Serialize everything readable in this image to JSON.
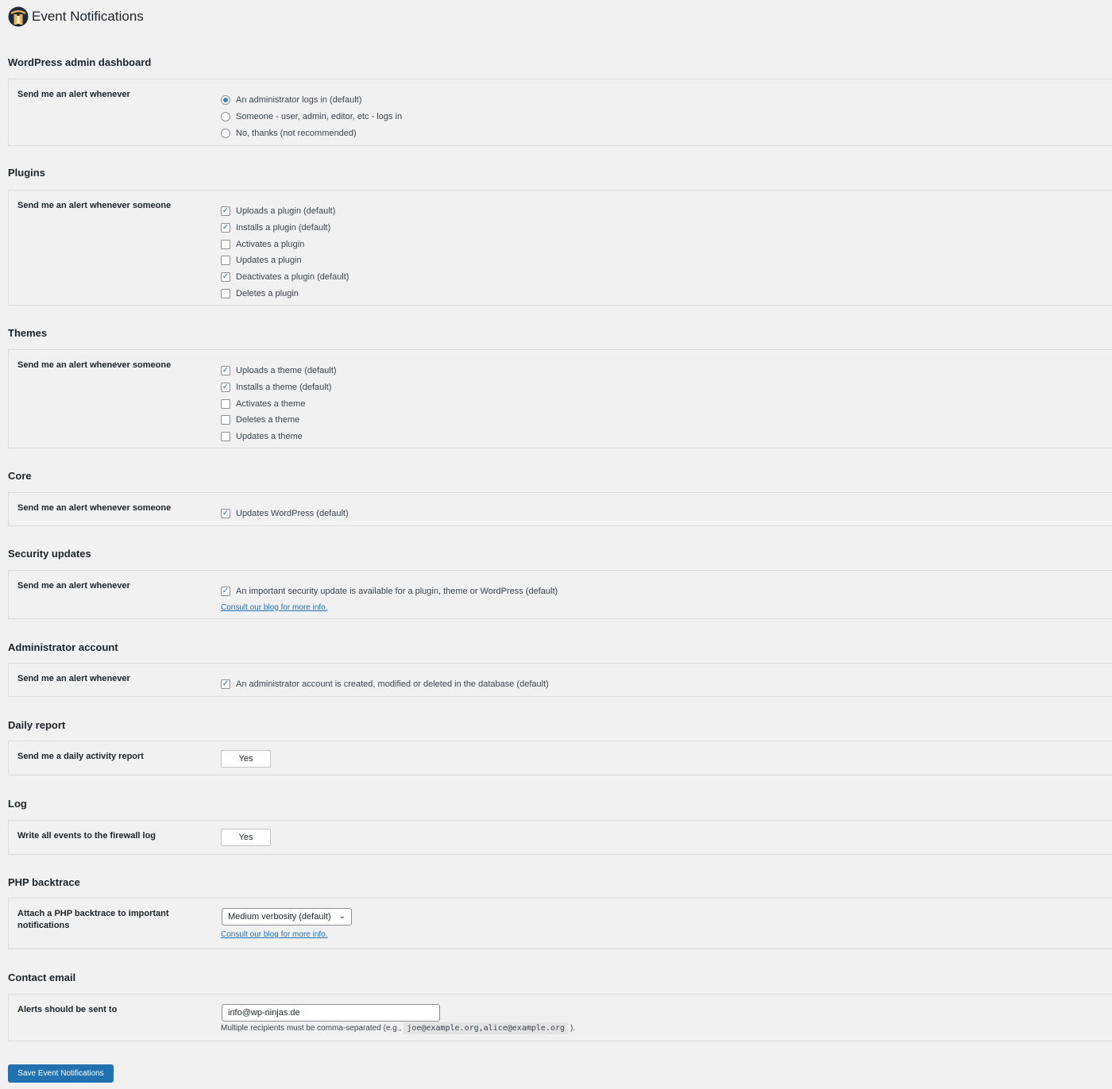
{
  "page": {
    "title": "Event Notifications"
  },
  "sections": {
    "dashboard": {
      "title": "WordPress admin dashboard",
      "label": "Send me an alert whenever",
      "options": [
        {
          "label": "An administrator logs in (default)",
          "checked": true
        },
        {
          "label": "Someone - user, admin, editor, etc - logs in",
          "checked": false
        },
        {
          "label": "No, thanks (not recommended)",
          "checked": false
        }
      ]
    },
    "plugins": {
      "title": "Plugins",
      "label": "Send me an alert whenever someone",
      "options": [
        {
          "label": "Uploads a plugin (default)",
          "checked": true
        },
        {
          "label": "Installs a plugin (default)",
          "checked": true
        },
        {
          "label": "Activates a plugin",
          "checked": false
        },
        {
          "label": "Updates a plugin",
          "checked": false
        },
        {
          "label": "Deactivates a plugin (default)",
          "checked": true
        },
        {
          "label": "Deletes a plugin",
          "checked": false
        }
      ]
    },
    "themes": {
      "title": "Themes",
      "label": "Send me an alert whenever someone",
      "options": [
        {
          "label": "Uploads a theme (default)",
          "checked": true
        },
        {
          "label": "Installs a theme (default)",
          "checked": true
        },
        {
          "label": "Activates a theme",
          "checked": false
        },
        {
          "label": "Deletes a theme",
          "checked": false
        },
        {
          "label": "Updates a theme",
          "checked": false
        }
      ]
    },
    "core": {
      "title": "Core",
      "label": "Send me an alert whenever someone",
      "options": [
        {
          "label": "Updates WordPress (default)",
          "checked": true
        }
      ]
    },
    "security": {
      "title": "Security updates",
      "label": "Send me an alert whenever",
      "options": [
        {
          "label": "An important security update is available for a plugin, theme or WordPress (default)",
          "checked": true
        }
      ],
      "link": "Consult our blog for more info."
    },
    "admin_account": {
      "title": "Administrator account",
      "label": "Send me an alert whenever",
      "options": [
        {
          "label": "An administrator account is created, modified or deleted in the database (default)",
          "checked": true
        }
      ]
    },
    "daily": {
      "title": "Daily report",
      "label": "Send me a daily activity report",
      "button": "Yes"
    },
    "log": {
      "title": "Log",
      "label": "Write all events to the firewall log",
      "button": "Yes"
    },
    "php": {
      "title": "PHP backtrace",
      "label": "Attach a PHP backtrace to important notifications",
      "select_value": "Medium verbosity (default)",
      "link": "Consult our blog for more info."
    },
    "contact": {
      "title": "Contact email",
      "label": "Alerts should be sent to",
      "email_value": "info@wp-ninjas.de",
      "hint_prefix": "Multiple recipients must be comma-separated (e.g.,",
      "hint_code": "joe@example.org,alice@example.org",
      "hint_suffix": ")."
    }
  },
  "save_button": "Save Event Notifications",
  "colors": {
    "accent": "#2271b1",
    "background": "#f1f1f1",
    "border": "#dcdcde"
  }
}
